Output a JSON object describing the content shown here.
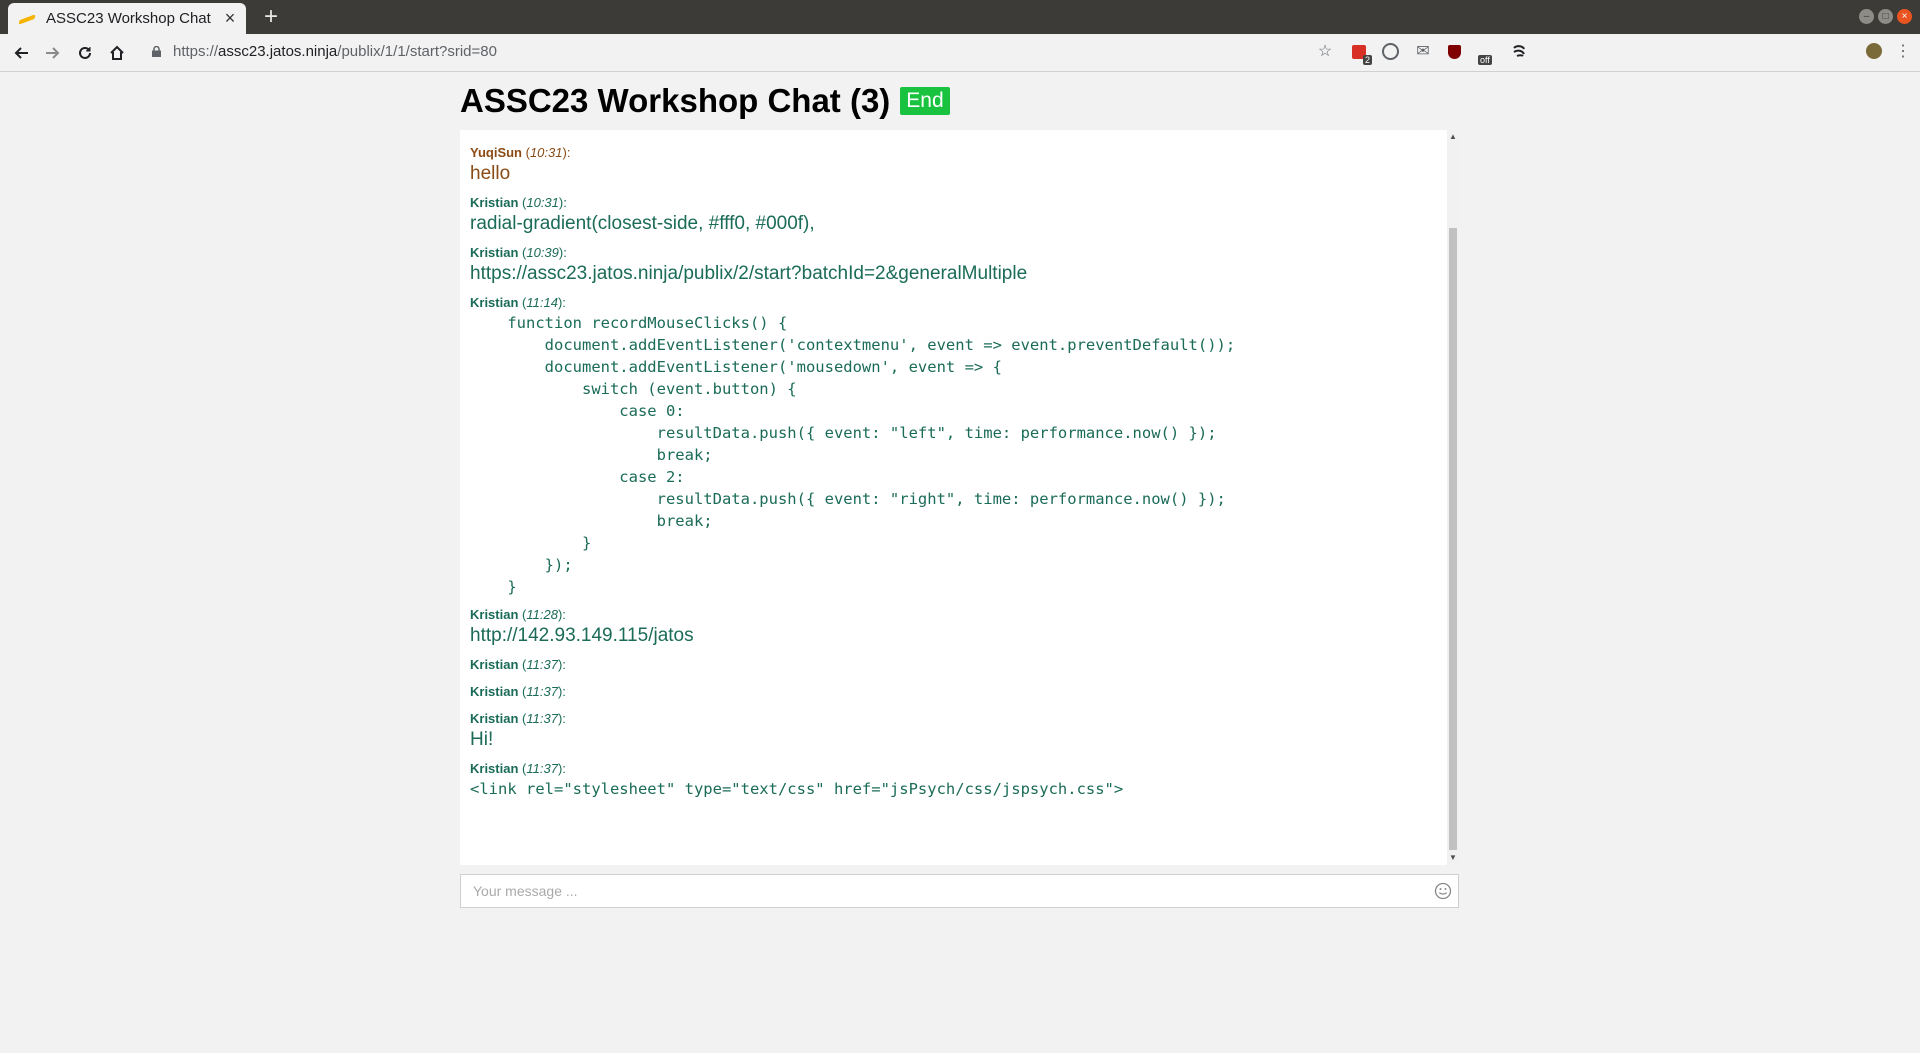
{
  "browser": {
    "tab_title": "ASSC23 Workshop Chat",
    "tab_close": "×",
    "new_tab": "+",
    "url_protocol": "https://",
    "url_host": "assc23.jatos.ninja",
    "url_path": "/publix/1/1/start?srid=80",
    "ext_badge_count": "2",
    "ext_off_label": "off"
  },
  "page": {
    "title": "ASSC23 Workshop Chat (3)",
    "end_label": "End"
  },
  "messages": [
    {
      "author": "YuqiSun",
      "time": "10:31",
      "text": "hello",
      "style": "brown"
    },
    {
      "author": "Kristian",
      "time": "10:31",
      "text": "radial-gradient(closest-side, #fff0, #000f),"
    },
    {
      "author": "Kristian",
      "time": "10:39",
      "text": "https://assc23.jatos.ninja/publix/2/start?batchId=2&generalMultiple"
    },
    {
      "author": "Kristian",
      "time": "11:14",
      "code": true,
      "text": "    function recordMouseClicks() {\n        document.addEventListener('contextmenu', event => event.preventDefault());\n        document.addEventListener('mousedown', event => {\n            switch (event.button) {\n                case 0:\n                    resultData.push({ event: \"left\", time: performance.now() });\n                    break;\n                case 2:\n                    resultData.push({ event: \"right\", time: performance.now() });\n                    break;\n            }\n        });\n    }"
    },
    {
      "author": "Kristian",
      "time": "11:28",
      "text": "http://142.93.149.115/jatos"
    },
    {
      "author": "Kristian",
      "time": "11:37",
      "text": ""
    },
    {
      "author": "Kristian",
      "time": "11:37",
      "text": ""
    },
    {
      "author": "Kristian",
      "time": "11:37",
      "text": "Hi!"
    },
    {
      "author": "Kristian",
      "time": "11:37",
      "code": true,
      "text": "<link rel=\"stylesheet\" type=\"text/css\" href=\"jsPsych/css/jspsych.css\">"
    }
  ],
  "input": {
    "placeholder": "Your message ..."
  },
  "colors": {
    "end_button": "#19c23f",
    "kristian_text": "#1a6b57",
    "yuqisun_text": "#8a4b14"
  }
}
